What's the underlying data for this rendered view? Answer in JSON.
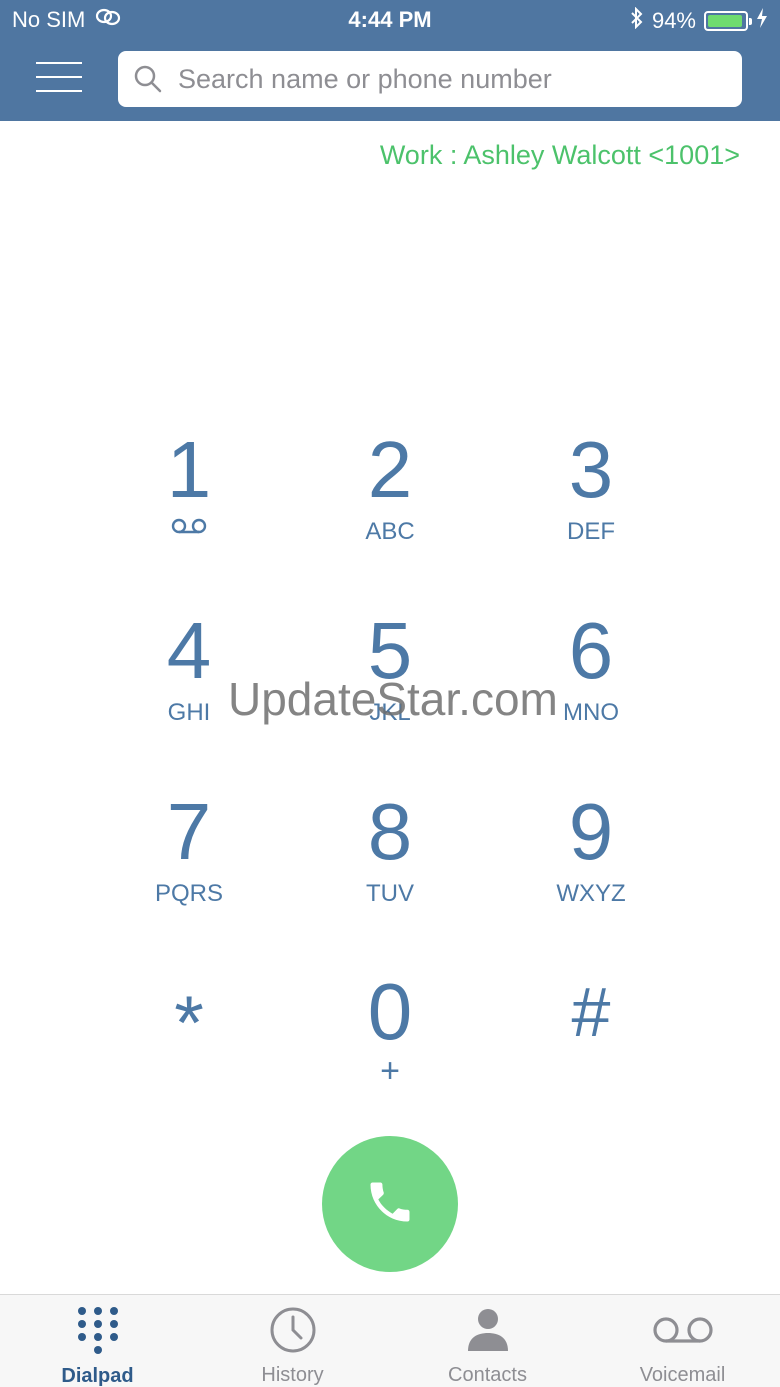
{
  "status_bar": {
    "carrier": "No SIM",
    "time": "4:44 PM",
    "battery_percent": "94%",
    "battery_level": 0.94
  },
  "search": {
    "placeholder": "Search name or phone number"
  },
  "account": {
    "label": "Work : Ashley Walcott <1001>"
  },
  "dialpad": {
    "keys": [
      {
        "digit": "1",
        "letters": ""
      },
      {
        "digit": "2",
        "letters": "ABC"
      },
      {
        "digit": "3",
        "letters": "DEF"
      },
      {
        "digit": "4",
        "letters": "GHI"
      },
      {
        "digit": "5",
        "letters": "JKL"
      },
      {
        "digit": "6",
        "letters": "MNO"
      },
      {
        "digit": "7",
        "letters": "PQRS"
      },
      {
        "digit": "8",
        "letters": "TUV"
      },
      {
        "digit": "9",
        "letters": "WXYZ"
      },
      {
        "digit": "*",
        "letters": ""
      },
      {
        "digit": "0",
        "letters": "+"
      },
      {
        "digit": "#",
        "letters": ""
      }
    ]
  },
  "watermark": "UpdateStar.com",
  "tabs": [
    {
      "label": "Dialpad",
      "icon": "dialpad-icon",
      "active": true
    },
    {
      "label": "History",
      "icon": "clock-icon",
      "active": false
    },
    {
      "label": "Contacts",
      "icon": "person-icon",
      "active": false
    },
    {
      "label": "Voicemail",
      "icon": "voicemail-icon",
      "active": false
    }
  ],
  "colors": {
    "header": "#4f76a1",
    "key_text": "#4d79a6",
    "account_text": "#4cc26b",
    "call_button": "#72d686",
    "active_tab": "#2f5b8a"
  }
}
